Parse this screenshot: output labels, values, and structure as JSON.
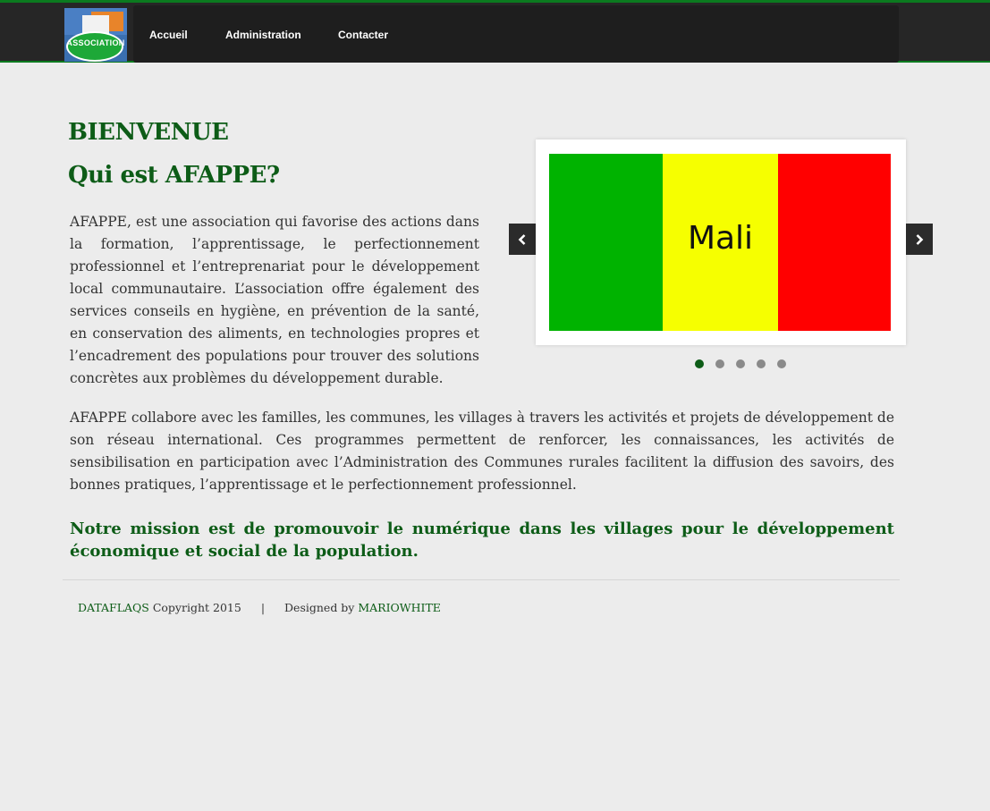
{
  "header": {
    "logo_text": "ASSOCIATION",
    "nav": [
      {
        "label": "Accueil"
      },
      {
        "label": "Administration"
      },
      {
        "label": "Contacter"
      }
    ]
  },
  "main": {
    "welcome": "BIENVENUE",
    "subtitle": "Qui est AFAPPE?",
    "paragraph1": "AFAPPE, est une association qui favorise des actions dans la formation, l’apprentissage, le perfectionnement professionnel et l’entreprenariat pour le développement local communautaire. L’association offre également des services conseils en hygiène, en prévention de la santé, en conservation des aliments, en technologies propres et l’encadrement des populations pour trouver des solutions concrètes aux problèmes du développement durable.",
    "paragraph2": "AFAPPE collabore avec les familles, les communes, les villages à travers les activités et projets de développement de son réseau international. Ces programmes permettent de renforcer, les connaissances, les activités de sensibilisation en participation avec l’Administration des Communes rurales facilitent la diffusion des savoirs, des bonnes pratiques, l’apprentissage et le perfectionnement professionnel.",
    "mission": "Notre mission est de promouvoir le numérique dans les villages pour le développement économique et social de la population."
  },
  "slider": {
    "slide_label": "Mali",
    "flag_colors": [
      "#00b300",
      "#f6ff00",
      "#ff0000"
    ],
    "dot_count": 5,
    "active_index": 0,
    "prev_icon": "chevron-left-icon",
    "next_icon": "chevron-right-icon"
  },
  "footer": {
    "brand": "DATAFLAQS",
    "copyright": "Copyright 2015",
    "separator": "|",
    "designed_by": "Designed by",
    "designer": "MARIOWHITE"
  },
  "colors": {
    "accent": "#0d5c17",
    "topbar": "#262626",
    "topbar_border": "#0b7a1f"
  }
}
